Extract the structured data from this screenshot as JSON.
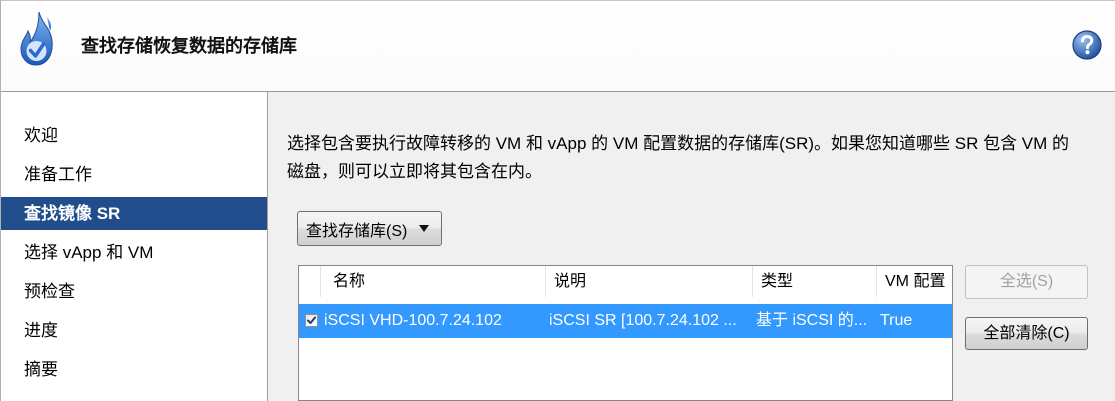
{
  "window": {
    "title": "查找存储恢复数据的存储库",
    "title_icon": "flame-icon",
    "help_icon": "help-icon"
  },
  "sidebar": {
    "items": [
      {
        "label": "欢迎",
        "selected": false
      },
      {
        "label": "准备工作",
        "selected": false
      },
      {
        "label": "查找镜像 SR",
        "selected": true
      },
      {
        "label": "选择 vApp 和 VM",
        "selected": false
      },
      {
        "label": "预检查",
        "selected": false
      },
      {
        "label": "进度",
        "selected": false
      },
      {
        "label": "摘要",
        "selected": false
      }
    ]
  },
  "main": {
    "instructions": [
      "选择包含要执行故障转移的 VM 和 vApp 的 VM 配置数据的存储库(SR)。如果您知道哪些 SR 包含 VM 的",
      "磁盘，则可以立即将其包含在内。"
    ],
    "find_button": {
      "label": "查找存储库(S)",
      "icon": "dropdown-arrow-icon"
    },
    "sr_table": {
      "columns": [
        "名称",
        "说明",
        "类型",
        "VM 配置"
      ],
      "rows": [
        {
          "checked": true,
          "selected": true,
          "name": "iSCSI VHD-100.7.24.102",
          "description": "iSCSI SR [100.7.24.102 ...",
          "type": "基于 iSCSI 的...",
          "vm_config": "True"
        }
      ]
    },
    "buttons": {
      "select_all": {
        "label": "全选(S)",
        "disabled": true
      },
      "clear_all": {
        "label": "全部清除(C)",
        "disabled": false
      }
    }
  },
  "colors": {
    "sidebar_selection": "#214d8c",
    "row_selection": "#3399ff",
    "content_background": "#f0f0f0"
  }
}
